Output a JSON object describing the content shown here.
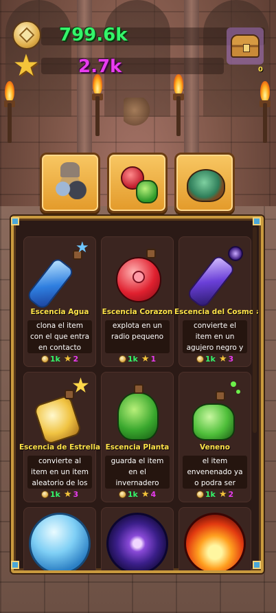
{
  "hud": {
    "gold": "799.6k",
    "stars": "2.7k",
    "chest_count": "0"
  },
  "tabs": [
    {
      "icon": "ores-tab-icon"
    },
    {
      "icon": "potions-tab-icon"
    },
    {
      "icon": "bag-tab-icon"
    }
  ],
  "items": [
    {
      "title": "Escencia Agua",
      "desc": "clona el item con el que entra en contacto",
      "gold_cost": "1k",
      "star_cost": "2",
      "icon": "blue-vial-icon"
    },
    {
      "title": "Escencia Corazon",
      "desc": "explota en un radio pequeno",
      "gold_cost": "1k",
      "star_cost": "1",
      "icon": "red-heart-potion-icon"
    },
    {
      "title": "Escencia del Cosmos",
      "desc": "convierte el item en un agujero negro y atrae todos los",
      "gold_cost": "1k",
      "star_cost": "3",
      "icon": "cosmos-vial-icon"
    },
    {
      "title": "Escencia de Estrella",
      "desc": "convierte al item en un item aleatorio de los",
      "gold_cost": "1k",
      "star_cost": "3",
      "icon": "star-potion-icon"
    },
    {
      "title": "Escencia Planta",
      "desc": "guarda el item en el invernadero",
      "gold_cost": "1k",
      "star_cost": "4",
      "icon": "plant-potion-icon"
    },
    {
      "title": "Veneno",
      "desc": "el item envenenado ya o podra ser",
      "gold_cost": "1k",
      "star_cost": "2",
      "icon": "poison-potion-icon"
    },
    {
      "title": "",
      "desc": "",
      "gold_cost": "",
      "star_cost": "",
      "icon": "water-orb-icon"
    },
    {
      "title": "",
      "desc": "",
      "gold_cost": "",
      "star_cost": "",
      "icon": "galaxy-orb-icon"
    },
    {
      "title": "",
      "desc": "",
      "gold_cost": "",
      "star_cost": "",
      "icon": "fire-orb-icon"
    }
  ]
}
